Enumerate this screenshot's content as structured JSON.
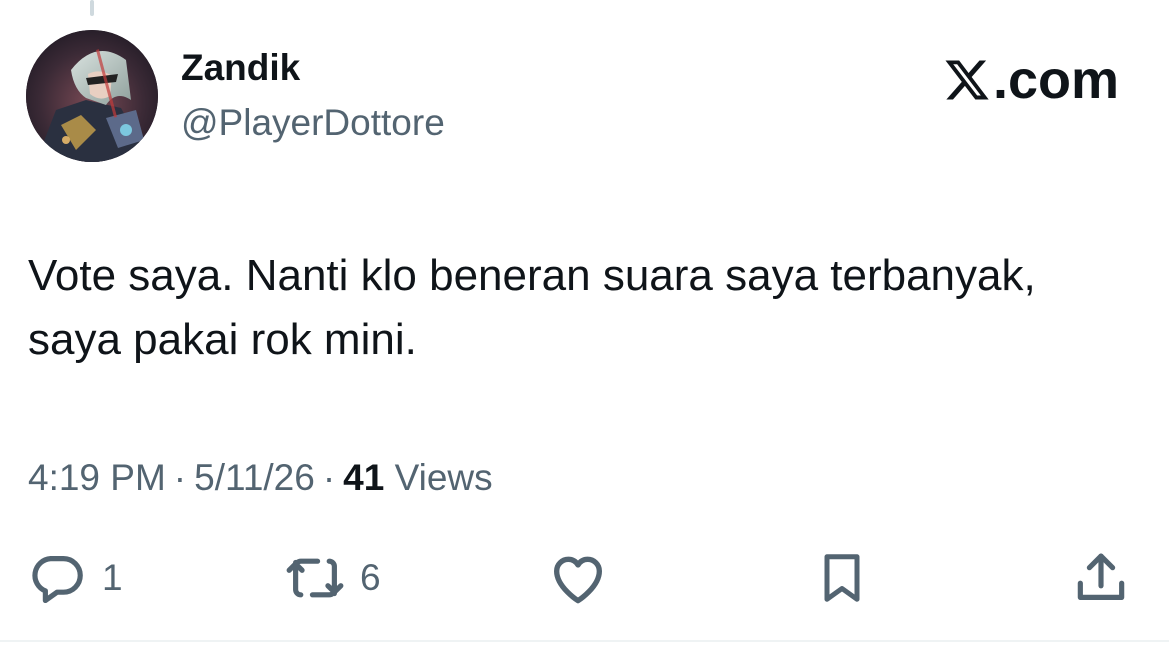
{
  "author": {
    "display_name": "Zandik",
    "handle": "@PlayerDottore",
    "avatar_icon": "character-avatar"
  },
  "brand": {
    "logo_icon": "x-logo-icon",
    "suffix": ".com"
  },
  "tweet": {
    "text": "Vote saya. Nanti klo beneran suara saya terbanyak, saya pakai rok mini."
  },
  "meta": {
    "time": "4:19 PM",
    "separator": "·",
    "date": "5/11/26",
    "views_count": "41",
    "views_label": "Views"
  },
  "actions": {
    "reply_count": "1",
    "retweet_count": "6"
  },
  "colors": {
    "text_primary": "#0f1419",
    "text_secondary": "#536471",
    "divider": "#eff3f4"
  }
}
